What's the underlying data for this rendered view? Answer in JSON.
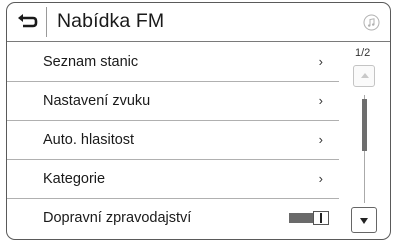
{
  "header": {
    "title": "Nabídka FM",
    "back_icon": "back-arrow-icon",
    "media_icon": "music-note-icon"
  },
  "menu": {
    "items": [
      {
        "label": "Seznam stanic",
        "chevron": "›"
      },
      {
        "label": "Nastavení zvuku",
        "chevron": "›"
      },
      {
        "label": "Auto. hlasitost",
        "chevron": "›"
      },
      {
        "label": "Kategorie",
        "chevron": "›"
      },
      {
        "label": "Dopravní zpravodajství",
        "toggle_mark": "I"
      }
    ]
  },
  "scroll": {
    "page_indicator": "1/2",
    "up_icon": "scroll-up-icon",
    "down_icon": "scroll-down-icon"
  }
}
